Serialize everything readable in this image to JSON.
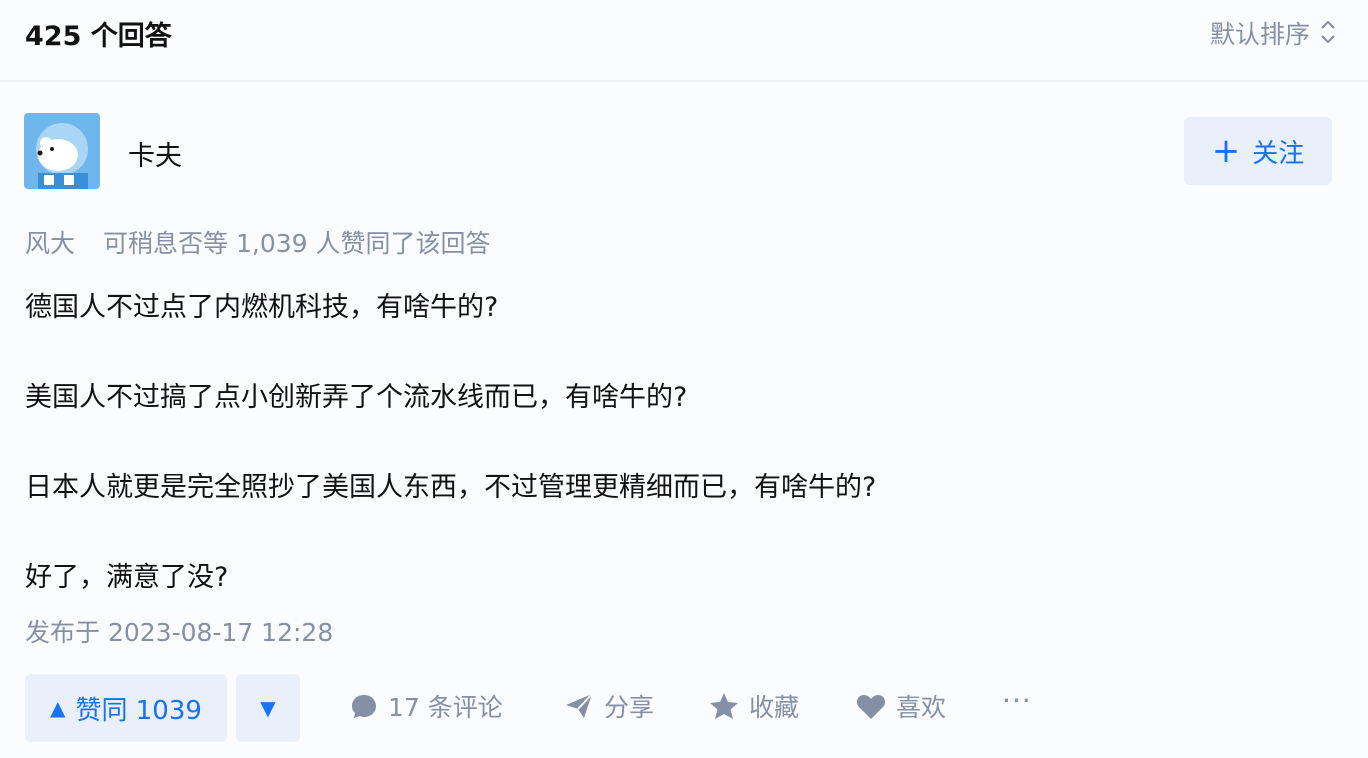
{
  "header": {
    "answer_count": "425 个回答",
    "sort_label": "默认排序"
  },
  "author": {
    "name": "卡夫",
    "follow_label": "关注"
  },
  "likers": {
    "names": "风大",
    "text": "可稍息否等 1,039 人赞同了该回答"
  },
  "content": {
    "paragraphs": [
      "德国人不过点了内燃机科技，有啥牛的?",
      "美国人不过搞了点小创新弄了个流水线而已，有啥牛的?",
      "日本人就更是完全照抄了美国人东西，不过管理更精细而已，有啥牛的?",
      "好了，满意了没?"
    ],
    "published": "发布于 2023-08-17 12:28"
  },
  "actions": {
    "upvote_label": "赞同 1039",
    "comments": "17 条评论",
    "share": "分享",
    "collect": "收藏",
    "like": "喜欢",
    "more": "···"
  },
  "icons": {
    "sort": "sort-updown-icon",
    "avatar": "bear-avatar",
    "follow": "plus-icon",
    "upvote": "triangle-up-icon",
    "downvote": "triangle-down-icon",
    "comment": "comment-bubble-icon",
    "share": "paper-plane-icon",
    "collect": "star-icon",
    "like": "heart-icon",
    "more": "ellipsis-icon"
  },
  "colors": {
    "accent": "#1772f6",
    "accent_bg": "#e9f0fb",
    "muted": "#8590a6",
    "text": "#121212"
  }
}
